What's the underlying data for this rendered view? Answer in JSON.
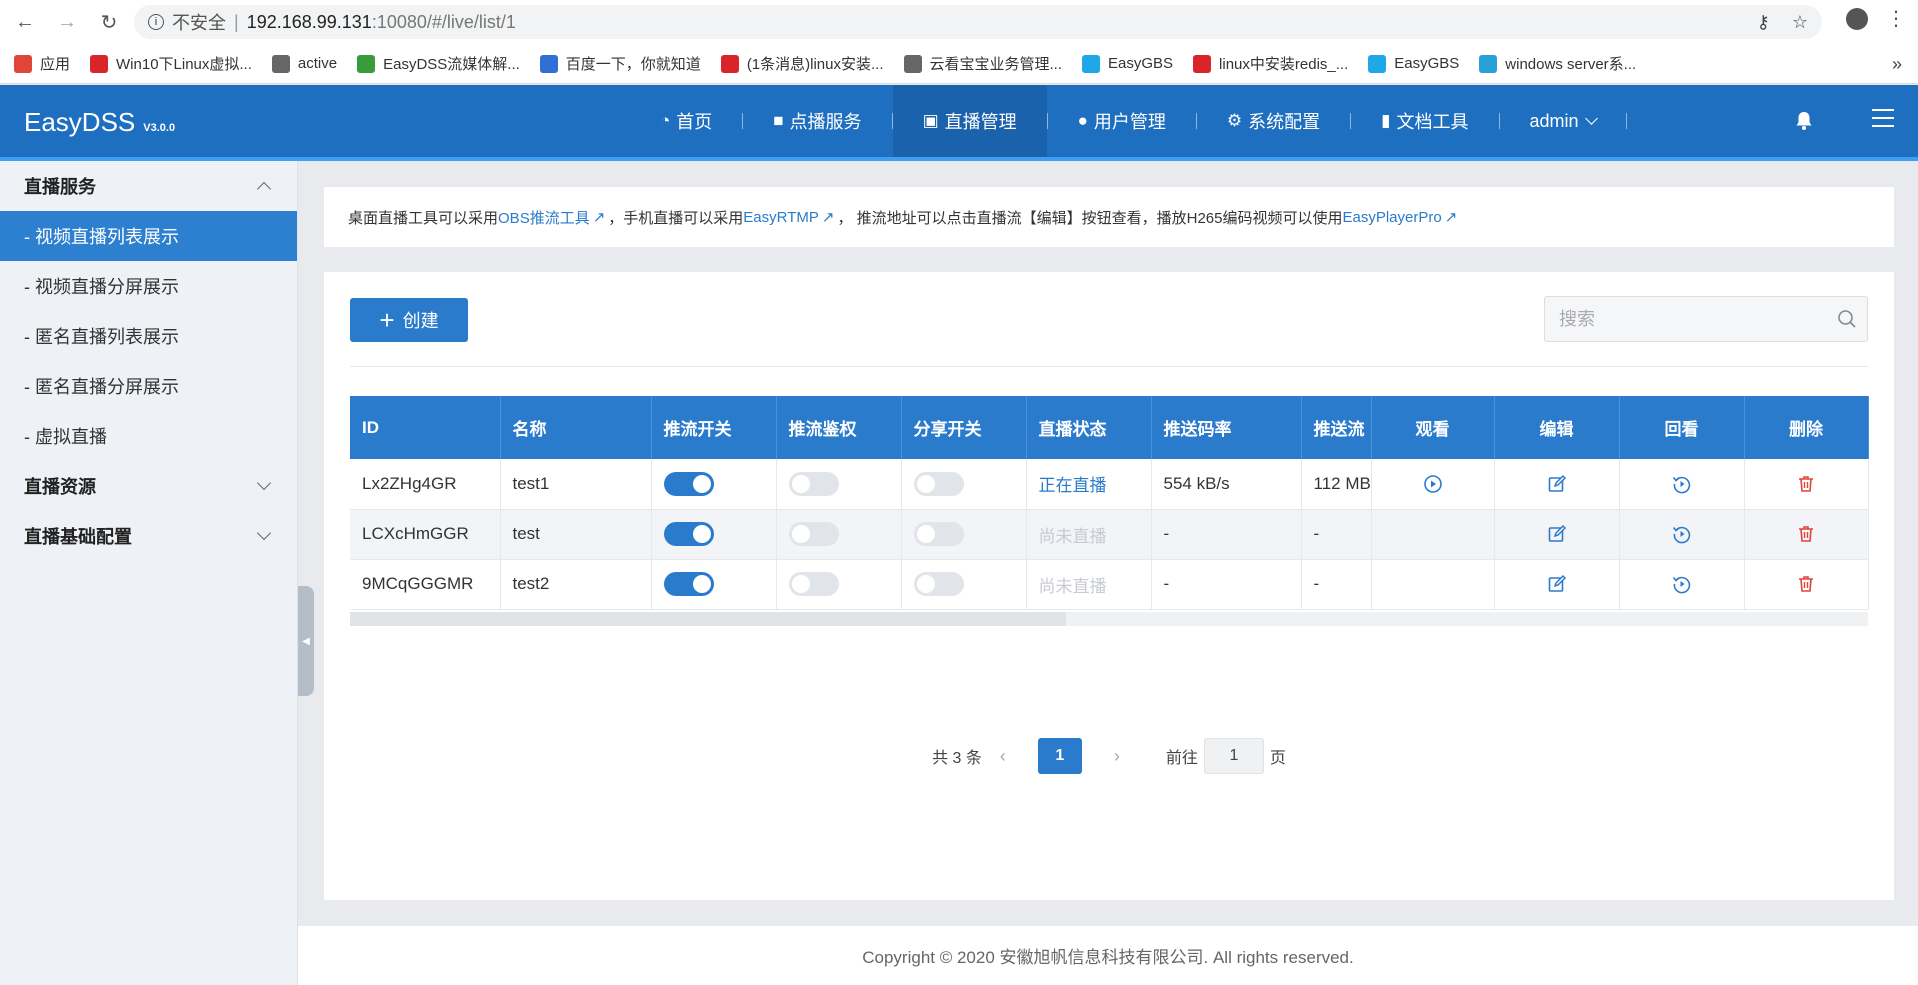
{
  "browser": {
    "insecure_label": "不安全",
    "url_host": "192.168.99.131",
    "url_path": ":10080/#/live/list/1",
    "bookmarks": [
      {
        "label": "应用",
        "icon": "apps-grid-icon",
        "color": "#e0453a"
      },
      {
        "label": "Win10下Linux虚拟...",
        "icon": "csdn-icon",
        "color": "#d9252a"
      },
      {
        "label": "active",
        "icon": "globe-icon",
        "color": "#666666"
      },
      {
        "label": "EasyDSS流媒体解...",
        "icon": "easydss-icon",
        "color": "#3a9b3a"
      },
      {
        "label": "百度一下，你就知道",
        "icon": "baidu-paw-icon",
        "color": "#2f6fd6"
      },
      {
        "label": "(1条消息)linux安装...",
        "icon": "csdn-icon",
        "color": "#d9252a"
      },
      {
        "label": "云看宝宝业务管理...",
        "icon": "globe-icon",
        "color": "#666666"
      },
      {
        "label": "EasyGBS",
        "icon": "easygbs-icon",
        "color": "#1fa8e8"
      },
      {
        "label": "linux中安装redis_...",
        "icon": "csdn-icon",
        "color": "#d9252a"
      },
      {
        "label": "EasyGBS",
        "icon": "easygbs-icon",
        "color": "#1fa8e8"
      },
      {
        "label": "windows server系...",
        "icon": "site-icon",
        "color": "#2aa0d8"
      }
    ],
    "more_glyph": "»"
  },
  "header": {
    "brand": "EasyDSS",
    "version": "V3.0.0",
    "nav": [
      {
        "label": "首页",
        "icon": "dashboard-icon",
        "glyph": "◔"
      },
      {
        "label": "点播服务",
        "icon": "video-camera-icon",
        "glyph": "■"
      },
      {
        "label": "直播管理",
        "icon": "live-tv-icon",
        "glyph": "▣",
        "active": true
      },
      {
        "label": "用户管理",
        "icon": "user-icon",
        "glyph": "●"
      },
      {
        "label": "系统配置",
        "icon": "gear-icon",
        "glyph": "⚙"
      },
      {
        "label": "文档工具",
        "icon": "book-icon",
        "glyph": "▮"
      }
    ],
    "user": "admin"
  },
  "sidebar": {
    "groups": [
      {
        "label": "直播服务",
        "expanded": true,
        "items": [
          {
            "label": "- 视频直播列表展示",
            "active": true
          },
          {
            "label": "- 视频直播分屏展示"
          },
          {
            "label": "- 匿名直播列表展示"
          },
          {
            "label": "- 匿名直播分屏展示"
          },
          {
            "label": "- 虚拟直播"
          }
        ]
      },
      {
        "label": "直播资源",
        "expanded": false
      },
      {
        "label": "直播基础配置",
        "expanded": false
      }
    ]
  },
  "notice": {
    "t1": "桌面直播工具可以采用 ",
    "link1": "OBS推流工具",
    "t2": "，手机直播可以采用 ",
    "link2": "EasyRTMP",
    "t3": "， 推流地址可以点击直播流【编辑】按钮查看，播放H265编码视频可以使用 ",
    "link3": "EasyPlayerPro"
  },
  "toolbar": {
    "create_label": "创建",
    "search_placeholder": "搜索"
  },
  "table": {
    "headers": [
      "ID",
      "名称",
      "推流开关",
      "推流鉴权",
      "分享开关",
      "直播状态",
      "推送码率",
      "推送流",
      "观看",
      "编辑",
      "回看",
      "删除"
    ],
    "rows": [
      {
        "id": "Lx2ZHg4GR",
        "name": "test1",
        "push": true,
        "auth": false,
        "share": false,
        "status": "正在直播",
        "live": true,
        "bitrate": "554 kB/s",
        "traffic": "112 MB",
        "watch": true
      },
      {
        "id": "LCXcHmGGR",
        "name": "test",
        "push": true,
        "auth": false,
        "share": false,
        "status": "尚未直播",
        "live": false,
        "bitrate": "-",
        "traffic": "-",
        "watch": false
      },
      {
        "id": "9MCqGGGMR",
        "name": "test2",
        "push": true,
        "auth": false,
        "share": false,
        "status": "尚未直播",
        "live": false,
        "bitrate": "-",
        "traffic": "-",
        "watch": false
      }
    ]
  },
  "pagination": {
    "total": "共 3 条",
    "current": "1",
    "goto_label": "前往",
    "goto_value": "1",
    "page_suffix": "页"
  },
  "footer": {
    "text": "Copyright © 2020 安徽旭帆信息科技有限公司. All rights reserved."
  },
  "colors": {
    "primary": "#2a7bcb",
    "header": "#1f6fc0",
    "delete": "#e0453a"
  }
}
